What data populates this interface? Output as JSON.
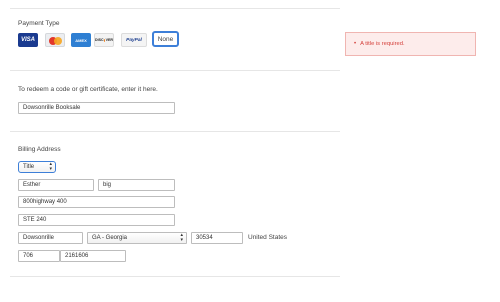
{
  "payment": {
    "title": "Payment Type",
    "cards": [
      {
        "name": "VISA",
        "icon": "visa-card-icon"
      },
      {
        "name": "MasterCard",
        "icon": "mastercard-card-icon"
      },
      {
        "name": "AMEX",
        "icon": "amex-card-icon"
      },
      {
        "name": "DISC VER",
        "icon": "discover-card-icon"
      },
      {
        "name": "PayPal",
        "icon": "paypal-card-icon"
      }
    ],
    "none_label": "None"
  },
  "error": {
    "message": "A title is required."
  },
  "redeem": {
    "instruction": "To redeem a code or gift certificate, enter it here.",
    "code_value": "Dowsonrille Booksale"
  },
  "billing": {
    "title": "Billing Address",
    "title_select": "Title",
    "first_name": "Esther",
    "last_name": "big",
    "address1": "800highway 400",
    "address2": "STE 240",
    "city": "Dowsonrille",
    "state": "GA - Georgia",
    "zip": "30534",
    "country": "United States",
    "phone_area": "706",
    "phone_number": "2161606"
  },
  "colors": {
    "accent": "#3d7fd8",
    "error_text": "#d43f3a",
    "error_bg": "#fdeceb"
  }
}
